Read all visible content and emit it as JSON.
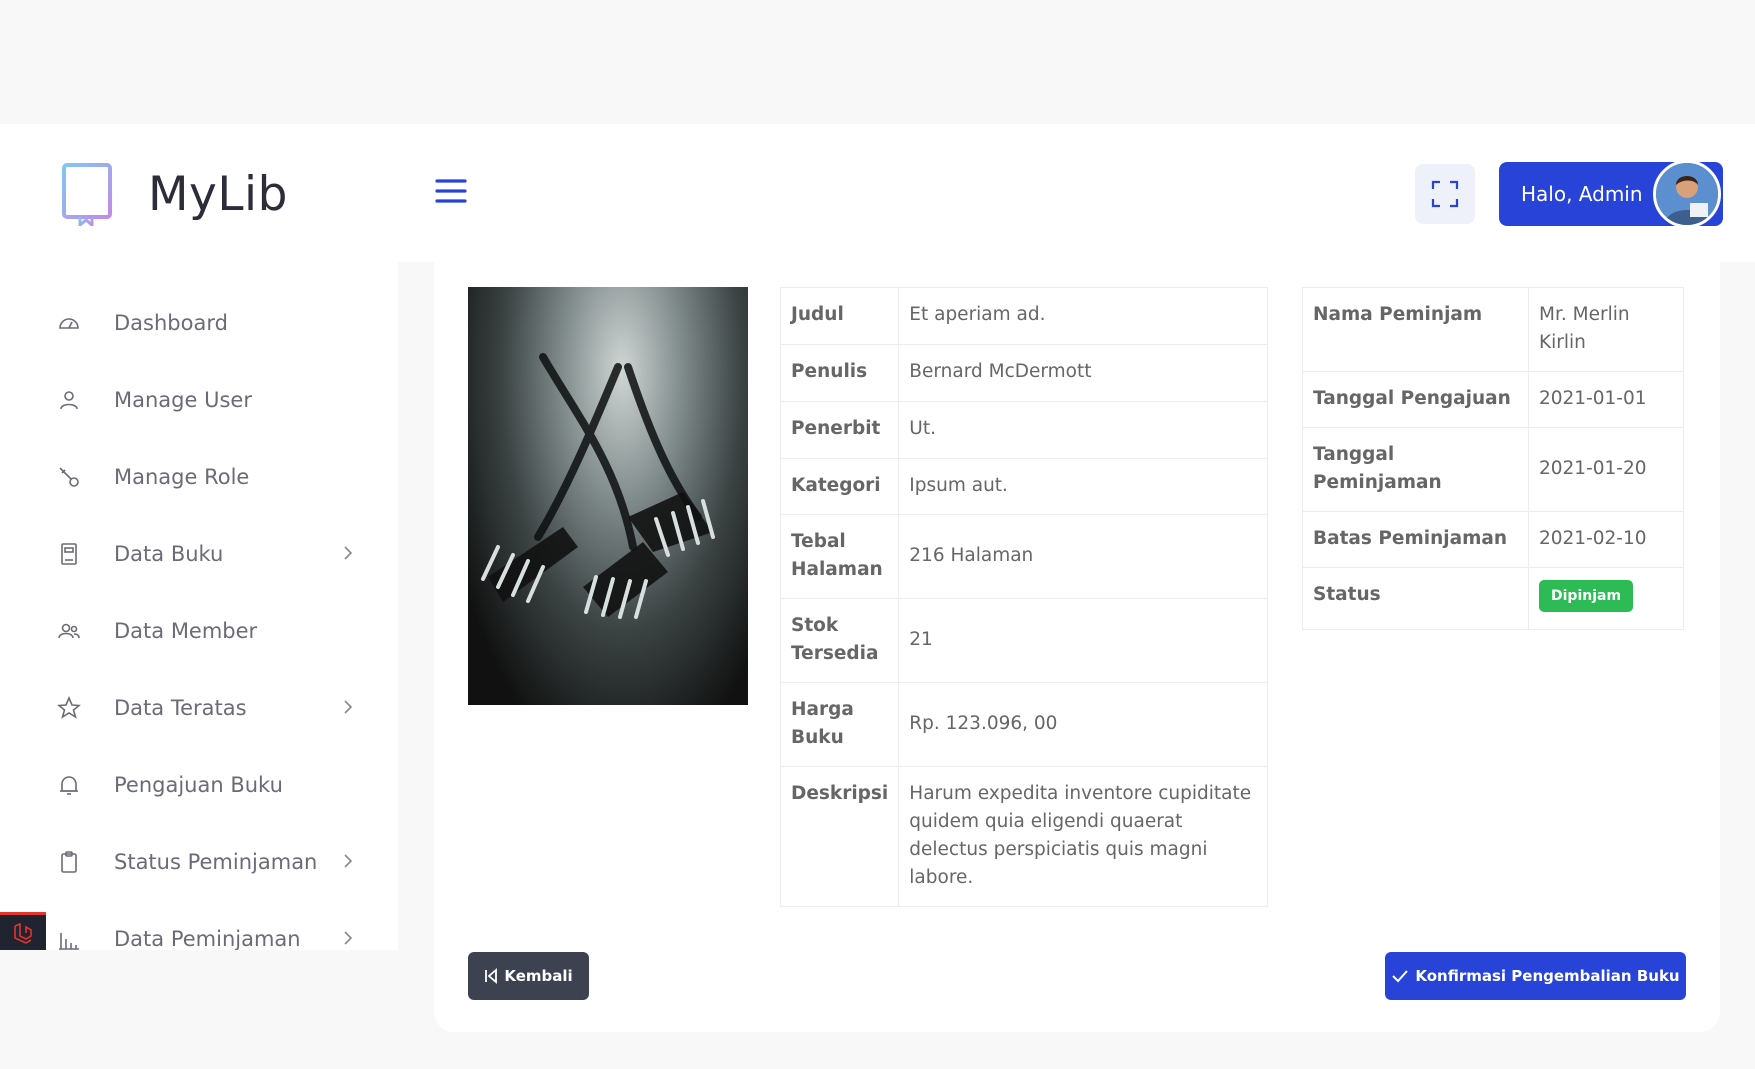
{
  "app": {
    "name": "MyLib"
  },
  "sidebar": {
    "items": [
      {
        "label": "Dashboard",
        "icon": "dashboard-icon",
        "has_submenu": false
      },
      {
        "label": "Manage User",
        "icon": "user-icon",
        "has_submenu": false
      },
      {
        "label": "Manage Role",
        "icon": "role-icon",
        "has_submenu": false
      },
      {
        "label": "Data Buku",
        "icon": "book-icon",
        "has_submenu": true
      },
      {
        "label": "Data Member",
        "icon": "members-icon",
        "has_submenu": false
      },
      {
        "label": "Data Teratas",
        "icon": "star-icon",
        "has_submenu": true
      },
      {
        "label": "Pengajuan Buku",
        "icon": "bell-icon",
        "has_submenu": false
      },
      {
        "label": "Status Peminjaman",
        "icon": "clipboard-icon",
        "has_submenu": true
      },
      {
        "label": "Data Peminjaman",
        "icon": "bar-chart-icon",
        "has_submenu": true
      }
    ]
  },
  "header": {
    "user_greeting": "Halo, Admin"
  },
  "book": {
    "rows": [
      {
        "key": "Judul",
        "value": "Et aperiam ad."
      },
      {
        "key": "Penulis",
        "value": "Bernard McDermott"
      },
      {
        "key": "Penerbit",
        "value": "Ut."
      },
      {
        "key": "Kategori",
        "value": "Ipsum aut."
      },
      {
        "key": "Tebal Halaman",
        "value": "216 Halaman"
      },
      {
        "key": "Stok Tersedia",
        "value": "21"
      },
      {
        "key": "Harga Buku",
        "value": "Rp. 123.096, 00"
      },
      {
        "key": "Deskripsi",
        "value": "Harum expedita inventore cupiditate quidem quia eligendi quaerat delectus perspiciatis quis magni labore."
      }
    ]
  },
  "loan": {
    "rows": [
      {
        "key": "Nama Peminjam",
        "value": "Mr. Merlin Kirlin"
      },
      {
        "key": "Tanggal Pengajuan",
        "value": "2021-01-01"
      },
      {
        "key": "Tanggal Peminjaman",
        "value": "2021-01-20"
      },
      {
        "key": "Batas Peminjaman",
        "value": "2021-02-10"
      }
    ],
    "status_label": "Status",
    "status_value": "Dipinjam",
    "status_color": "#2dbb55"
  },
  "actions": {
    "back_label": "Kembali",
    "confirm_label": "Konfirmasi Pengembalian Buku"
  },
  "colors": {
    "primary": "#2743d8",
    "dark_button": "#3d4250"
  }
}
